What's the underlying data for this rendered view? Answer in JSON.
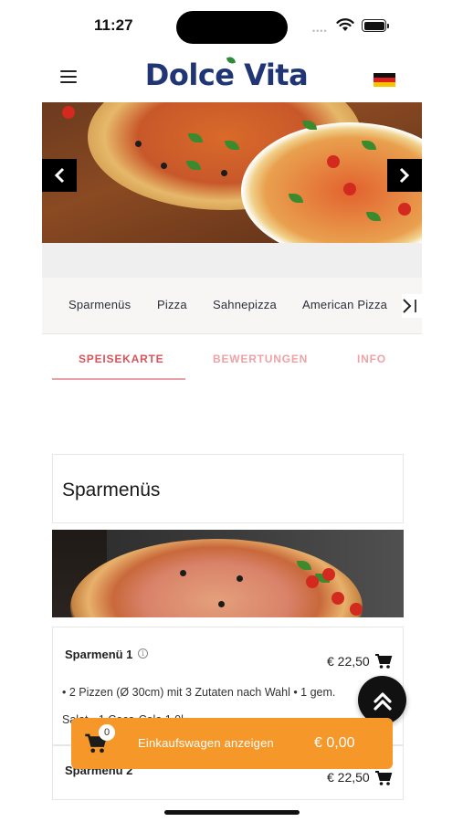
{
  "status_bar": {
    "time": "11:27",
    "signal": "••••"
  },
  "header": {
    "logo_text": "Dolce Vita",
    "language_flag": "de-flag-icon"
  },
  "hero": {
    "prev_label": "❮",
    "next_label": "❯"
  },
  "categories": {
    "items": [
      "Sparmenüs",
      "Pizza",
      "Sahnepizza",
      "American Pizza"
    ],
    "more_label": ">"
  },
  "tabs": [
    {
      "label": "SPEISEKARTE",
      "active": true
    },
    {
      "label": "BEWERTUNGEN",
      "active": false
    },
    {
      "label": "INFO",
      "active": false
    }
  ],
  "section": {
    "title": "Sparmenüs"
  },
  "items": [
    {
      "name": "Sparmenü 1",
      "price": "€ 22,50",
      "description": "• 2 Pizzen (Ø 30cm) mit 3 Zutaten nach Wahl • 1 gem. Salat • 1 Coca-Cola 1,0l"
    },
    {
      "name": "Sparmenü 2",
      "price": "€ 22,50"
    }
  ],
  "cart": {
    "count": "0",
    "label": "Einkaufswagen anzeigen",
    "total": "€ 0,00"
  },
  "colors": {
    "accent_tab": "#d9535b",
    "cart_bar": "#f6972a",
    "logo": "#1f3576"
  }
}
